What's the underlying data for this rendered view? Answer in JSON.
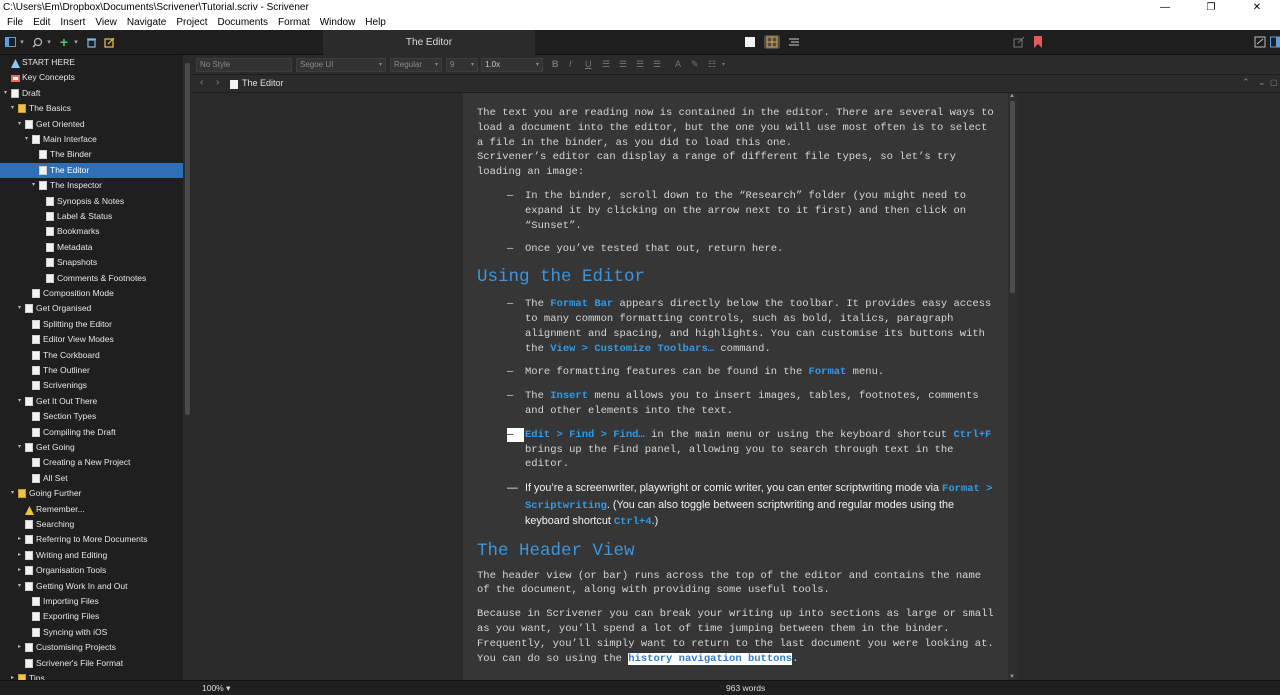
{
  "window": {
    "title": "C:\\Users\\Em\\Dropbox\\Documents\\Scrivener\\Tutorial.scriv - Scrivener",
    "minimize": "—",
    "maximize": "❐",
    "close": "✕"
  },
  "menu": [
    "File",
    "Edit",
    "Insert",
    "View",
    "Navigate",
    "Project",
    "Documents",
    "Format",
    "Window",
    "Help"
  ],
  "toolbar": {
    "document_title": "The Editor"
  },
  "format_bar": {
    "style": "No Style",
    "font": "Segoe UI",
    "weight": "Regular",
    "size": "9",
    "line_spacing": "1.0x",
    "bold": "B",
    "italic": "I",
    "underline": "U",
    "text_color": "A"
  },
  "header": {
    "title": "The Editor",
    "back": "‹",
    "forward": "›"
  },
  "binder": [
    {
      "label": "START HERE",
      "level": 0,
      "icon": "star",
      "arrow": ""
    },
    {
      "label": "Key Concepts",
      "level": 0,
      "icon": "key",
      "arrow": ""
    },
    {
      "label": "Draft",
      "level": 0,
      "icon": "draft",
      "arrow": "▾"
    },
    {
      "label": "The Basics",
      "level": 1,
      "icon": "folder",
      "arrow": "▾"
    },
    {
      "label": "Get Oriented",
      "level": 2,
      "icon": "doc",
      "arrow": "▾"
    },
    {
      "label": "Main Interface",
      "level": 3,
      "icon": "doc",
      "arrow": "▾"
    },
    {
      "label": "The Binder",
      "level": 4,
      "icon": "doc",
      "arrow": ""
    },
    {
      "label": "The Editor",
      "level": 4,
      "icon": "doc",
      "arrow": "",
      "selected": true
    },
    {
      "label": "The Inspector",
      "level": 4,
      "icon": "doc",
      "arrow": "▾"
    },
    {
      "label": "Synopsis & Notes",
      "level": 5,
      "icon": "doc",
      "arrow": ""
    },
    {
      "label": "Label & Status",
      "level": 5,
      "icon": "doc",
      "arrow": ""
    },
    {
      "label": "Bookmarks",
      "level": 5,
      "icon": "doc",
      "arrow": ""
    },
    {
      "label": "Metadata",
      "level": 5,
      "icon": "doc",
      "arrow": ""
    },
    {
      "label": "Snapshots",
      "level": 5,
      "icon": "doc",
      "arrow": ""
    },
    {
      "label": "Comments & Footnotes",
      "level": 5,
      "icon": "doc",
      "arrow": ""
    },
    {
      "label": "Composition Mode",
      "level": 3,
      "icon": "doc",
      "arrow": ""
    },
    {
      "label": "Get Organised",
      "level": 2,
      "icon": "doc",
      "arrow": "▾"
    },
    {
      "label": "Splitting the Editor",
      "level": 3,
      "icon": "doc",
      "arrow": ""
    },
    {
      "label": "Editor View Modes",
      "level": 3,
      "icon": "doc",
      "arrow": ""
    },
    {
      "label": "The Corkboard",
      "level": 3,
      "icon": "doc",
      "arrow": ""
    },
    {
      "label": "The Outliner",
      "level": 3,
      "icon": "doc",
      "arrow": ""
    },
    {
      "label": "Scrivenings",
      "level": 3,
      "icon": "doc",
      "arrow": ""
    },
    {
      "label": "Get It Out There",
      "level": 2,
      "icon": "doc",
      "arrow": "▾"
    },
    {
      "label": "Section Types",
      "level": 3,
      "icon": "doc",
      "arrow": ""
    },
    {
      "label": "Compiling the Draft",
      "level": 3,
      "icon": "doc",
      "arrow": ""
    },
    {
      "label": "Get Going",
      "level": 2,
      "icon": "doc",
      "arrow": "▾"
    },
    {
      "label": "Creating a New Project",
      "level": 3,
      "icon": "doc",
      "arrow": ""
    },
    {
      "label": "All Set",
      "level": 3,
      "icon": "doc",
      "arrow": ""
    },
    {
      "label": "Going Further",
      "level": 1,
      "icon": "folder",
      "arrow": "▾"
    },
    {
      "label": "Remember...",
      "level": 2,
      "icon": "warn",
      "arrow": ""
    },
    {
      "label": "Searching",
      "level": 2,
      "icon": "doc",
      "arrow": ""
    },
    {
      "label": "Referring to More Documents",
      "level": 2,
      "icon": "doc",
      "arrow": "▸"
    },
    {
      "label": "Writing and Editing",
      "level": 2,
      "icon": "doc",
      "arrow": "▸"
    },
    {
      "label": "Organisation Tools",
      "level": 2,
      "icon": "doc",
      "arrow": "▸"
    },
    {
      "label": "Getting Work In and Out",
      "level": 2,
      "icon": "doc",
      "arrow": "▾"
    },
    {
      "label": "Importing Files",
      "level": 3,
      "icon": "doc",
      "arrow": ""
    },
    {
      "label": "Exporting Files",
      "level": 3,
      "icon": "doc",
      "arrow": ""
    },
    {
      "label": "Syncing with iOS",
      "level": 3,
      "icon": "doc",
      "arrow": ""
    },
    {
      "label": "Customising Projects",
      "level": 2,
      "icon": "doc",
      "arrow": "▸"
    },
    {
      "label": "Scrivener's File Format",
      "level": 2,
      "icon": "doc",
      "arrow": ""
    },
    {
      "label": "Tips",
      "level": 1,
      "icon": "folder",
      "arrow": "▸"
    }
  ],
  "editor": {
    "intro1": "The text you are reading now is contained in the editor. There are several ways to load a document into the editor, but the one you will use most often is to select a file in the binder, as you did to load this one.",
    "intro2": "Scrivener’s editor can display a range of different file types, so let’s try loading an image:",
    "b1": "In the binder, scroll down to the “Research” folder (you might need to expand it by clicking on the arrow next to it first) and then click on “Sunset”.",
    "b2": "Once you’ve tested that out, return here.",
    "h_using": "Using the Editor",
    "fb_pre": "The ",
    "fb_cmd": "Format Bar",
    "fb_post": " appears directly below the toolbar. It provides easy access to many common formatting controls, such as bold, italics, paragraph alignment and spacing, and highlights. You can customise its buttons with the ",
    "fb_cmd2": "View > Customize Toolbars…",
    "fb_end": " command.",
    "more_pre": "More formatting features can be found in the ",
    "more_cmd": "Format",
    "more_post": " menu.",
    "ins_pre": "The ",
    "ins_cmd": "Insert",
    "ins_post": " menu allows you to insert images, tables, footnotes, comments and other elements into the text.",
    "find_cmd": "Edit > Find > Find…",
    "find_mid": " in the main menu or using the keyboard shortcut ",
    "find_key": "Ctrl+F",
    "find_post": " brings up the Find panel, allowing you to search through text in the editor.",
    "sw_pre": "If you’re a screenwriter, playwright or comic writer, you can enter scriptwriting mode via ",
    "sw_cmd": "Format > Scriptwriting",
    "sw_mid": ". (You can also toggle between scriptwriting and regular modes using the keyboard shortcut ",
    "sw_key": "Ctrl+4",
    "sw_end": ".)",
    "h_header": "The Header View",
    "hv1": "The header view (or bar) runs across the top of the editor and contains the name of the document, along with providing some useful tools.",
    "hv2_pre": "Because in Scrivener you can break your writing up into sections as large or small as you want, you’ll spend a lot of time jumping between them in the binder. Frequently, you’ll simply want to return to the last document you were looking at. You can do so using the ",
    "hv2_sel": "history navigation buttons",
    "hv2_end": "."
  },
  "footer": {
    "zoom": "100%",
    "words": "963 words"
  },
  "colors": {
    "accent": "#3a96e0",
    "selection": "#2f6fb8"
  }
}
